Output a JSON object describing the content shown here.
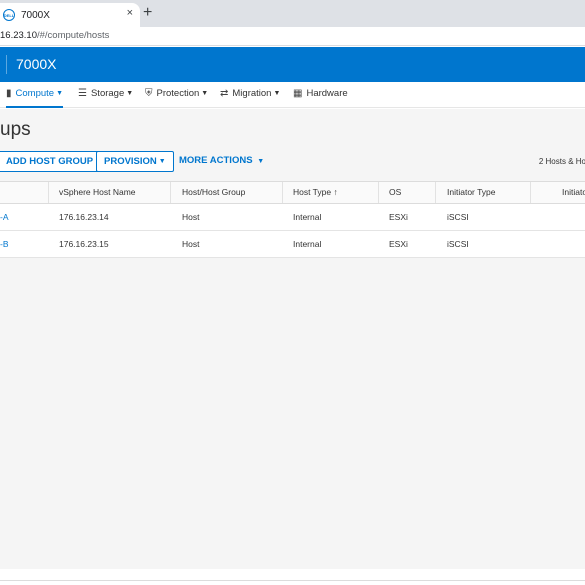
{
  "browser": {
    "tab_title": "7000X",
    "tab_close": "×",
    "new_tab": "+",
    "url_host": "16.23.10",
    "url_path": "/#/compute/hosts"
  },
  "app": {
    "title": "7000X"
  },
  "nav": {
    "items": [
      {
        "label": "Compute",
        "icon": "server-icon",
        "active": true
      },
      {
        "label": "Storage",
        "icon": "database-icon",
        "active": false
      },
      {
        "label": "Protection",
        "icon": "shield-icon",
        "active": false
      },
      {
        "label": "Migration",
        "icon": "migration-icon",
        "active": false
      },
      {
        "label": "Hardware",
        "icon": "hardware-icon",
        "active": false
      }
    ]
  },
  "page": {
    "title": "ups",
    "add_host_group": "ADD HOST GROUP",
    "provision": "PROVISION",
    "more_actions": "MORE ACTIONS",
    "count": "2 Hosts & Ho"
  },
  "table": {
    "columns": [
      "vSphere Host Name",
      "Host/Host Group",
      "Host Type ↑",
      "OS",
      "Initiator Type",
      "Initiato"
    ],
    "rows": [
      {
        "name": "-A",
        "vsphere": "176.16.23.14",
        "host_group": "Host",
        "host_type": "Internal",
        "os": "ESXi",
        "initiator_type": "iSCSI"
      },
      {
        "name": "-B",
        "vsphere": "176.16.23.15",
        "host_group": "Host",
        "host_type": "Internal",
        "os": "ESXi",
        "initiator_type": "iSCSI"
      }
    ]
  },
  "colors": {
    "accent": "#0076ce",
    "header_bg": "#0076ce",
    "content_bg": "#f5f5f5"
  }
}
